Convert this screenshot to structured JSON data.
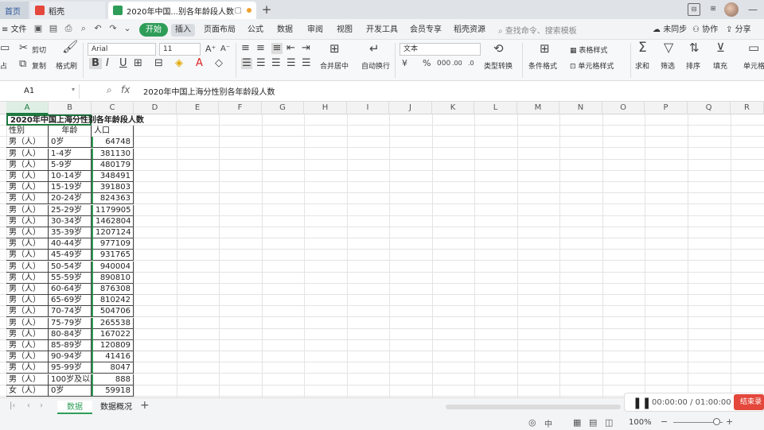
{
  "tabs": {
    "home": "首页",
    "daoke": "稻壳",
    "active": "2020年中国...别各年龄段人数"
  },
  "menu": {
    "file": "文件",
    "start": "开始",
    "insert": "插入",
    "items": [
      "页面布局",
      "公式",
      "数据",
      "审阅",
      "视图",
      "开发工具",
      "会员专享",
      "稻壳资源"
    ],
    "search": "查找命令、搜索模板",
    "sync": "未同步",
    "collab": "协作",
    "share": "分享"
  },
  "toolbar": {
    "cut": "剪切",
    "copy": "复制",
    "format_painter": "格式刷",
    "paste": "粘贴",
    "font_name": "Arial",
    "font_size": "11",
    "merge": "合并居中",
    "wrap": "自动换行",
    "number_format": "文本",
    "type_convert": "类型转换",
    "cond_format": "条件格式",
    "table_style": "表格样式",
    "cell_style": "单元格样式",
    "sum": "求和",
    "filter": "筛选",
    "sort": "排序",
    "fill": "填充",
    "cell": "单元格"
  },
  "formula_bar": {
    "name_box": "A1",
    "fx": "fx",
    "content": "2020年中国上海分性别各年龄段人数"
  },
  "grid": {
    "columns": [
      "A",
      "B",
      "C",
      "D",
      "E",
      "F",
      "G",
      "H",
      "I",
      "J",
      "K",
      "L",
      "M",
      "N",
      "O",
      "P",
      "Q",
      "R"
    ],
    "title": "2020年中国上海分性别各年龄段人数",
    "headers": [
      "性别",
      "年龄",
      "人口"
    ],
    "rows": [
      [
        "男（人）",
        "0岁",
        "64748"
      ],
      [
        "男（人）",
        "1-4岁",
        "381130"
      ],
      [
        "男（人）",
        "5-9岁",
        "480179"
      ],
      [
        "男（人）",
        "10-14岁",
        "348491"
      ],
      [
        "男（人）",
        "15-19岁",
        "391803"
      ],
      [
        "男（人）",
        "20-24岁",
        "824363"
      ],
      [
        "男（人）",
        "25-29岁",
        "1179905"
      ],
      [
        "男（人）",
        "30-34岁",
        "1462804"
      ],
      [
        "男（人）",
        "35-39岁",
        "1207124"
      ],
      [
        "男（人）",
        "40-44岁",
        "977109"
      ],
      [
        "男（人）",
        "45-49岁",
        "931765"
      ],
      [
        "男（人）",
        "50-54岁",
        "940004"
      ],
      [
        "男（人）",
        "55-59岁",
        "890810"
      ],
      [
        "男（人）",
        "60-64岁",
        "876308"
      ],
      [
        "男（人）",
        "65-69岁",
        "810242"
      ],
      [
        "男（人）",
        "70-74岁",
        "504706"
      ],
      [
        "男（人）",
        "75-79岁",
        "265538"
      ],
      [
        "男（人）",
        "80-84岁",
        "167022"
      ],
      [
        "男（人）",
        "85-89岁",
        "120809"
      ],
      [
        "男（人）",
        "90-94岁",
        "41416"
      ],
      [
        "男（人）",
        "95-99岁",
        "8047"
      ],
      [
        "男（人）",
        "100岁及以",
        "888"
      ],
      [
        "女（人）",
        "0岁",
        "59918"
      ]
    ]
  },
  "sheets": [
    "数据",
    "数据概况"
  ],
  "recorder": {
    "time": "00:00:00 / 01:00:00",
    "stop": "结束录"
  },
  "status": {
    "zoom": "100%"
  }
}
